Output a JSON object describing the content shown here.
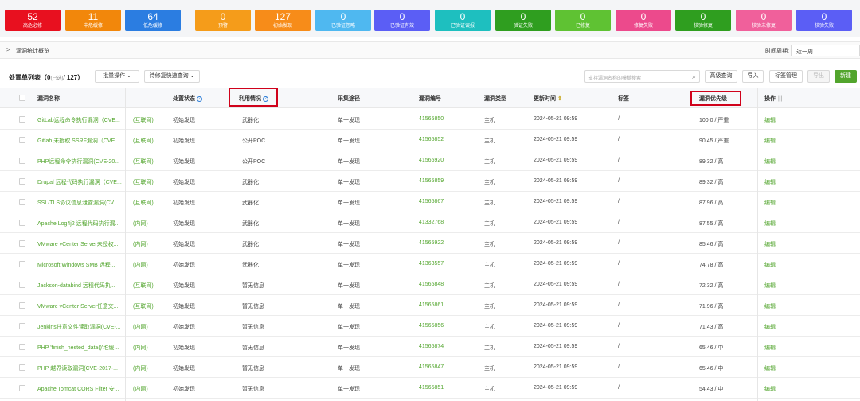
{
  "stats": [
    {
      "num": "52",
      "label": "高危必修",
      "color": "#e8101f"
    },
    {
      "num": "11",
      "label": "中危缓修",
      "color": "#f2870b"
    },
    {
      "num": "64",
      "label": "低危缓修",
      "color": "#2b7de1"
    },
    {
      "num": "0",
      "label": "预警",
      "color": "#f59c1a"
    },
    {
      "num": "127",
      "label": "初始发现",
      "color": "#f78c19"
    },
    {
      "num": "0",
      "label": "已验证忽略",
      "color": "#4fb8f0"
    },
    {
      "num": "0",
      "label": "已验证有效",
      "color": "#5b5ef5"
    },
    {
      "num": "0",
      "label": "已验证误报",
      "color": "#1ebfbf"
    },
    {
      "num": "0",
      "label": "验证失败",
      "color": "#2f9e1f"
    },
    {
      "num": "0",
      "label": "已修复",
      "color": "#5fc233"
    },
    {
      "num": "0",
      "label": "修复失败",
      "color": "#ec4a8c"
    },
    {
      "num": "0",
      "label": "核验修复",
      "color": "#2f9e1f"
    },
    {
      "num": "0",
      "label": "核验未修复",
      "color": "#f0609b"
    },
    {
      "num": "0",
      "label": "核验失败",
      "color": "#5b5ef5"
    }
  ],
  "overview": {
    "chevron": ">",
    "title": "漏洞统计概览",
    "period_label": "时间周期:",
    "period_value": "近一周"
  },
  "toolbar": {
    "list_title": "处置单列表（0",
    "selected": "(已选)",
    "total": "/ 127）",
    "batch": "批量操作 ⌄",
    "query": "待修复快速查询 ⌄",
    "search_placeholder": "支持漏洞名称的模糊搜索",
    "advanced": "高级查询",
    "import": "导入",
    "tags": "标签管理",
    "export": "导出",
    "new": "新建"
  },
  "table": {
    "headers": {
      "name": "漏洞名称",
      "status": "处置状态",
      "exploit": "利用情况",
      "channel": "采集途径",
      "id": "漏洞编号",
      "type": "漏洞类型",
      "updated": "更新时间",
      "tag": "标签",
      "priority": "漏洞优先级",
      "actions": "操作"
    },
    "rows": [
      {
        "name": "GitLab远程命令执行漏洞（CVE...",
        "net": "(互联网)",
        "status": "初始发现",
        "exploit": "武器化",
        "channel": "单一发现",
        "id": "41565850",
        "type": "主机",
        "updated": "2024-05-21 09:59",
        "tag": "/",
        "priority": "100.0 / 严重",
        "action": "编辑"
      },
      {
        "name": "Gitlab 未授权 SSRF漏洞（CVE...",
        "net": "(互联网)",
        "status": "初始发现",
        "exploit": "公开POC",
        "channel": "单一发现",
        "id": "41565852",
        "type": "主机",
        "updated": "2024-05-21 09:59",
        "tag": "/",
        "priority": "90.45 / 严重",
        "action": "编辑"
      },
      {
        "name": "PHP远程命令执行漏洞(CVE-20...",
        "net": "(互联网)",
        "status": "初始发现",
        "exploit": "公开POC",
        "channel": "单一发现",
        "id": "41565920",
        "type": "主机",
        "updated": "2024-05-21 09:59",
        "tag": "/",
        "priority": "89.32 / 高",
        "action": "编辑"
      },
      {
        "name": "Drupal 远程代码执行漏洞（CVE...",
        "net": "(互联网)",
        "status": "初始发现",
        "exploit": "武器化",
        "channel": "单一发现",
        "id": "41565859",
        "type": "主机",
        "updated": "2024-05-21 09:59",
        "tag": "/",
        "priority": "89.32 / 高",
        "action": "编辑"
      },
      {
        "name": "SSL/TLS协议信息泄露漏洞(CV...",
        "net": "(互联网)",
        "status": "初始发现",
        "exploit": "武器化",
        "channel": "单一发现",
        "id": "41565867",
        "type": "主机",
        "updated": "2024-05-21 09:59",
        "tag": "/",
        "priority": "87.96 / 高",
        "action": "编辑"
      },
      {
        "name": "Apache Log4j2 远程代码执行漏...",
        "net": "(内网)",
        "status": "初始发现",
        "exploit": "武器化",
        "channel": "单一发现",
        "id": "41332768",
        "type": "主机",
        "updated": "2024-05-21 09:59",
        "tag": "/",
        "priority": "87.55 / 高",
        "action": "编辑"
      },
      {
        "name": "VMware vCenter Server未授权...",
        "net": "(内网)",
        "status": "初始发现",
        "exploit": "武器化",
        "channel": "单一发现",
        "id": "41565922",
        "type": "主机",
        "updated": "2024-05-21 09:59",
        "tag": "/",
        "priority": "85.46 / 高",
        "action": "编辑"
      },
      {
        "name": "Microsoft Windows SMB 远程...",
        "net": "(内网)",
        "status": "初始发现",
        "exploit": "武器化",
        "channel": "单一发现",
        "id": "41363557",
        "type": "主机",
        "updated": "2024-05-21 09:59",
        "tag": "/",
        "priority": "74.78 / 高",
        "action": "编辑"
      },
      {
        "name": "Jackson-databind 远程代码执...",
        "net": "(互联网)",
        "status": "初始发现",
        "exploit": "暂无信息",
        "channel": "单一发现",
        "id": "41565848",
        "type": "主机",
        "updated": "2024-05-21 09:59",
        "tag": "/",
        "priority": "72.32 / 高",
        "action": "编辑"
      },
      {
        "name": "VMware vCenter Server任意文...",
        "net": "(互联网)",
        "status": "初始发现",
        "exploit": "暂无信息",
        "channel": "单一发现",
        "id": "41565861",
        "type": "主机",
        "updated": "2024-05-21 09:59",
        "tag": "/",
        "priority": "71.96 / 高",
        "action": "编辑"
      },
      {
        "name": "Jenkins任意文件读取漏洞(CVE-...",
        "net": "(内网)",
        "status": "初始发现",
        "exploit": "暂无信息",
        "channel": "单一发现",
        "id": "41565856",
        "type": "主机",
        "updated": "2024-05-21 09:59",
        "tag": "/",
        "priority": "71.43 / 高",
        "action": "编辑"
      },
      {
        "name": "PHP 'finish_nested_data()'堆缓...",
        "net": "(内网)",
        "status": "初始发现",
        "exploit": "暂无信息",
        "channel": "单一发现",
        "id": "41565874",
        "type": "主机",
        "updated": "2024-05-21 09:59",
        "tag": "/",
        "priority": "65.46 / 中",
        "action": "编辑"
      },
      {
        "name": "PHP 越界读取漏洞(CVE-2017-...",
        "net": "(内网)",
        "status": "初始发现",
        "exploit": "暂无信息",
        "channel": "单一发现",
        "id": "41565847",
        "type": "主机",
        "updated": "2024-05-21 09:59",
        "tag": "/",
        "priority": "65.46 / 中",
        "action": "编辑"
      },
      {
        "name": "Apache Tomcat CORS Filter 安...",
        "net": "(内网)",
        "status": "初始发现",
        "exploit": "暂无信息",
        "channel": "单一发现",
        "id": "41565851",
        "type": "主机",
        "updated": "2024-05-21 09:59",
        "tag": "/",
        "priority": "54.43 / 中",
        "action": "编辑"
      }
    ]
  }
}
